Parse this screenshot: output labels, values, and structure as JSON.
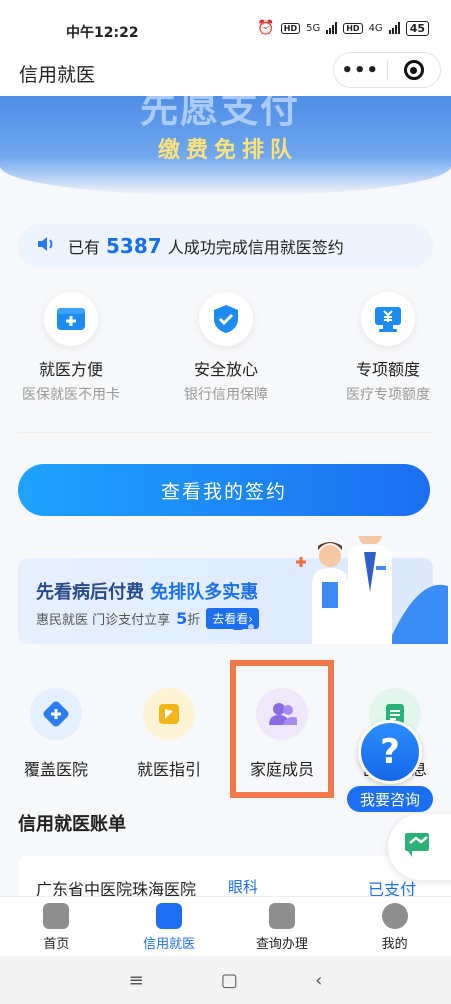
{
  "status_bar": {
    "time": "中午12:22",
    "battery": "45",
    "net1": "5G",
    "net2": "4G",
    "hd": "HD"
  },
  "header": {
    "title": "信用就医",
    "more_label": "•••"
  },
  "banner": {
    "headline": "先愿支付",
    "subtitle": "缴费免排队"
  },
  "notice": {
    "prefix": "已有",
    "count": "5387",
    "suffix": "人成功完成信用就医签约"
  },
  "features": [
    {
      "title": "就医方便",
      "desc": "医保就医不用卡",
      "icon": "medical-card-icon"
    },
    {
      "title": "安全放心",
      "desc": "银行信用保障",
      "icon": "shield-check-icon"
    },
    {
      "title": "专项额度",
      "desc": "医疗专项额度",
      "icon": "quota-icon"
    }
  ],
  "main_button": {
    "label": "查看我的签约"
  },
  "promo": {
    "title_a": "先看病后付费 ",
    "title_b": "免排队多实惠",
    "desc_a": "惠民就医 门诊支付立享",
    "discount": "5",
    "desc_b": "折",
    "cta": "去看看›"
  },
  "services": [
    {
      "label": "覆盖医院",
      "icon": "hospital-plus-icon",
      "bg": "#e4efff",
      "fg": "#2a7cf0"
    },
    {
      "label": "就医指引",
      "icon": "guide-flag-icon",
      "bg": "#fff3d6",
      "fg": "#f5b51a"
    },
    {
      "label": "家庭成员",
      "icon": "family-members-icon",
      "bg": "#efe8fc",
      "fg": "#8b6ae6"
    },
    {
      "label": "医保信息",
      "icon": "insurance-info-icon",
      "bg": "#e2f6ee",
      "fg": "#2bb27b"
    }
  ],
  "consult": {
    "fab_label": "?",
    "label": "我要咨询"
  },
  "bills": {
    "title": "信用就医账单",
    "items": [
      {
        "hospital": "广东省中医院珠海医院",
        "dept": "眼科",
        "status": "已支付"
      }
    ]
  },
  "tabbar": [
    {
      "label": "首页",
      "active": false
    },
    {
      "label": "信用就医",
      "active": true
    },
    {
      "label": "查询办理",
      "active": false
    },
    {
      "label": "我的",
      "active": false
    }
  ],
  "system_nav": {
    "menu": "≡",
    "home": "▢",
    "back": "‹"
  },
  "colors": {
    "accent": "#1c6ff0",
    "highlight_border": "#f27a4a"
  }
}
